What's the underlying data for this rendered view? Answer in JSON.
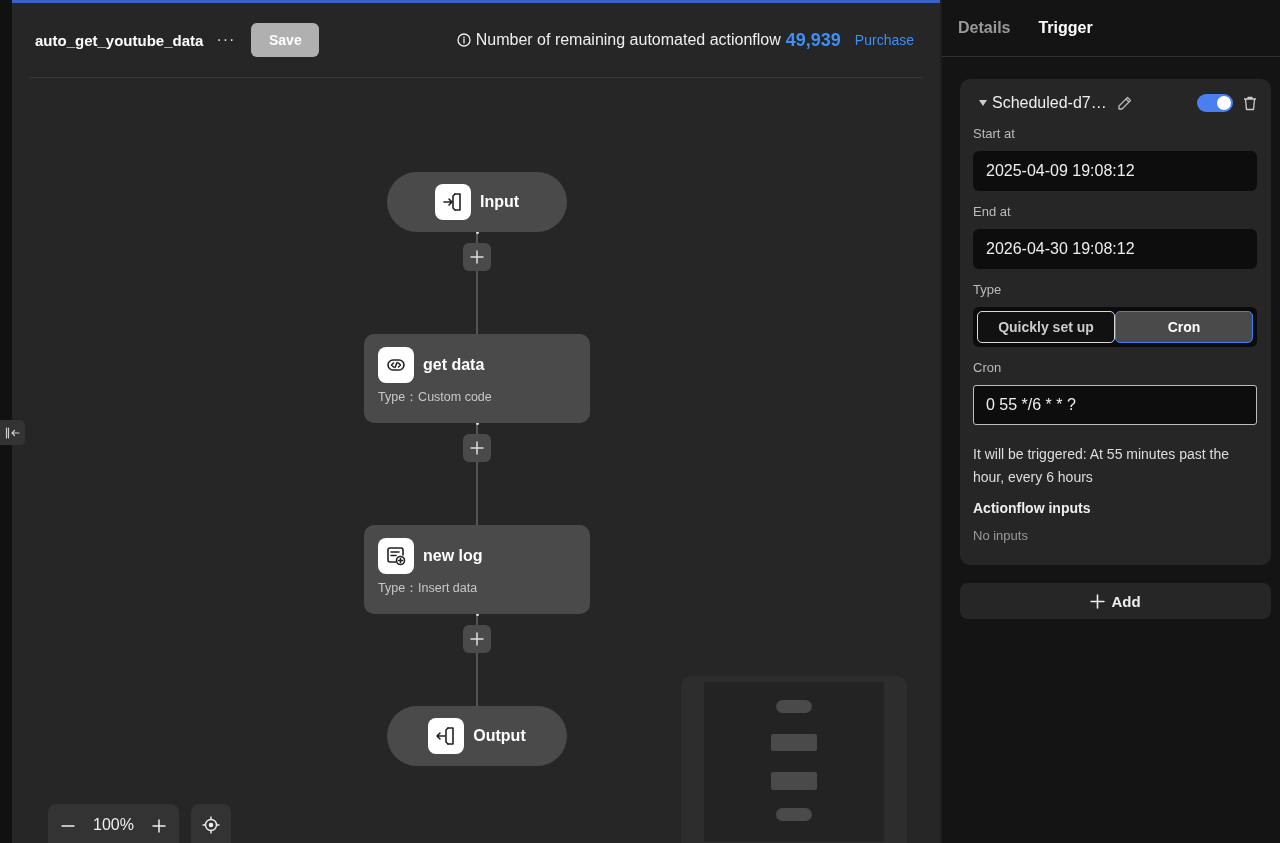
{
  "header": {
    "title": "auto_get_youtube_data",
    "more": "···",
    "save_button": {
      "label": "Save",
      "disabled": true
    },
    "quota_label": "Number of remaining automated actionflow",
    "quota_count": "49,939",
    "purchase_link": "Purchase"
  },
  "flow": {
    "nodes": [
      {
        "kind": "input",
        "label": "Input"
      },
      {
        "kind": "code",
        "label": "get data",
        "type_text": "Type：Custom code"
      },
      {
        "kind": "insert",
        "label": "new log",
        "type_text": "Type：Insert data"
      },
      {
        "kind": "output",
        "label": "Output"
      }
    ]
  },
  "zoom": {
    "value": "100%"
  },
  "tabs": [
    {
      "label": "Details",
      "selected": false
    },
    {
      "label": "Trigger",
      "selected": true
    }
  ],
  "trigger": {
    "name": "Scheduled-d7…",
    "expanded": true,
    "enabled": true,
    "fields": [
      {
        "label": "Start at",
        "value": "2025-04-09 19:08:12"
      },
      {
        "label": "End at",
        "value": "2026-04-30 19:08:12"
      }
    ],
    "type_label": "Type",
    "type_options": [
      {
        "label": "Quickly set up",
        "selected": false
      },
      {
        "label": "Cron",
        "selected": true
      }
    ],
    "cron_label": "Cron",
    "cron_value": "0 55 */6 * * ?",
    "description": "It will be triggered: At 55 minutes past the hour, every 6 hours",
    "inputs_title": "Actionflow inputs",
    "inputs_empty": "No inputs"
  },
  "add_button": "Add"
}
